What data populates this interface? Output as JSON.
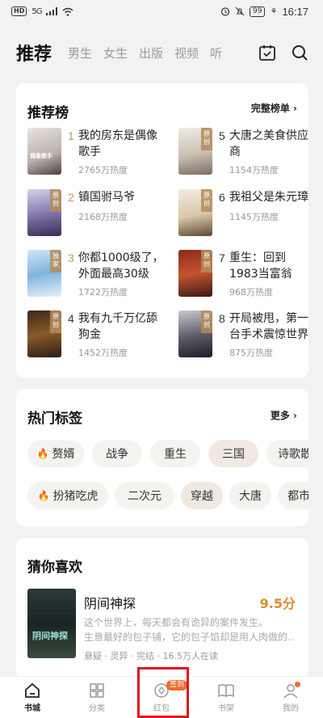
{
  "status": {
    "signal": "5G",
    "battery": "99",
    "time": "16:17"
  },
  "nav": {
    "tabs": [
      "推荐",
      "男生",
      "女生",
      "出版",
      "视频",
      "听"
    ]
  },
  "ranking": {
    "title": "推荐榜",
    "more": "完整榜单 ›",
    "items": [
      {
        "num": "1",
        "title": "我的房东是偶像歌手",
        "heat": "2765万热度",
        "badge": ""
      },
      {
        "num": "2",
        "title": "镇国驸马爷",
        "heat": "2168万热度",
        "badge": "原创"
      },
      {
        "num": "3",
        "title": "你都1000级了，外面最高30级",
        "heat": "1722万热度",
        "badge": "独家"
      },
      {
        "num": "4",
        "title": "我有九千万亿舔狗金",
        "heat": "1452万热度",
        "badge": "原创"
      },
      {
        "num": "5",
        "title": "大唐之美食供应商",
        "heat": "1154万热度",
        "badge": "原创"
      },
      {
        "num": "6",
        "title": "我祖父是朱元璋",
        "heat": "1145万热度",
        "badge": "原创"
      },
      {
        "num": "7",
        "title": "重生：回到1983当富翁",
        "heat": "968万热度",
        "badge": "原创"
      },
      {
        "num": "8",
        "title": "开局被甩，第一台手术震惊世界",
        "heat": "875万热度",
        "badge": "原创"
      }
    ]
  },
  "tags": {
    "title": "热门标签",
    "more": "更多 ›",
    "row1": [
      "赘婿",
      "战争",
      "重生",
      "三国",
      "诗歌散文"
    ],
    "row2": [
      "扮猪吃虎",
      "二次元",
      "穿越",
      "大唐",
      "都市"
    ]
  },
  "guess": {
    "title": "猜你喜欢",
    "book": {
      "title": "阴间神探",
      "score": "9.5分",
      "desc1": "这个世界上，每天都会有诡异的案件发生。",
      "desc2": "生意最好的包子铺，它的包子馅却是用人肉做的…",
      "meta": "悬疑 · 灵异 · 完结 · 16.5万人在读",
      "cover_text": "阴间神探"
    }
  },
  "bottom": {
    "items": [
      "书城",
      "分类",
      "红包",
      "书架",
      "我的"
    ],
    "checkin": "签到"
  },
  "colors": {
    "accent": "#f06a2a",
    "rank_gold": "#c49a5a",
    "score": "#e08a2e",
    "highlight_box": "#e0141e"
  }
}
